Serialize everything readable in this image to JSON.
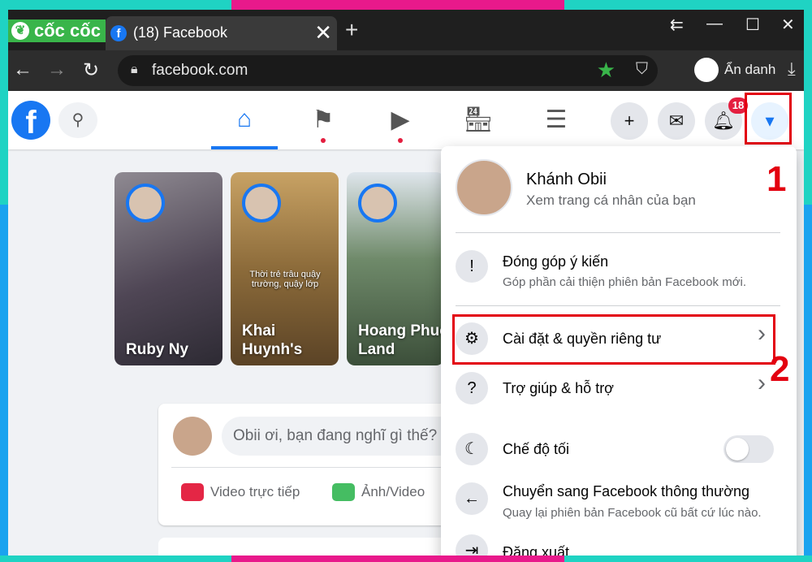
{
  "browser": {
    "brand": "cốc cốc",
    "tab_title": "(18) Facebook",
    "url": "facebook.com",
    "incognito_label": "Ẩn danh"
  },
  "facebook": {
    "notification_count": "18"
  },
  "stories": [
    {
      "name": "Ruby Ny",
      "caption": ""
    },
    {
      "name": "Khai Huynh's",
      "caption": "Thời trẻ trâu quậy trường, quậy lớp"
    },
    {
      "name": "Hoang Phuc Land",
      "caption": ""
    }
  ],
  "composer": {
    "placeholder": "Obii ơi, bạn đang nghĩ gì thế?",
    "live_label": "Video trực tiếp",
    "photo_label": "Ảnh/Video"
  },
  "menu": {
    "profile_name": "Khánh Obii",
    "profile_sub": "Xem trang cá nhân của bạn",
    "feedback_title": "Đóng góp ý kiến",
    "feedback_sub": "Góp phần cải thiện phiên bản Facebook mới.",
    "settings": "Cài đặt & quyền riêng tư",
    "help": "Trợ giúp & hỗ trợ",
    "dark_mode": "Chế độ tối",
    "dark_mode_on": false,
    "switch_title": "Chuyển sang Facebook thông thường",
    "switch_sub": "Quay lại phiên bản Facebook cũ bất cứ lúc nào.",
    "logout": "Đăng xuất"
  },
  "annotations": {
    "step1": "1",
    "step2": "2"
  },
  "colors": {
    "facebook_blue": "#1877f2",
    "highlight_red": "#e3000f",
    "frame_teal": "#1fd3c3",
    "frame_pink": "#e8198b"
  }
}
